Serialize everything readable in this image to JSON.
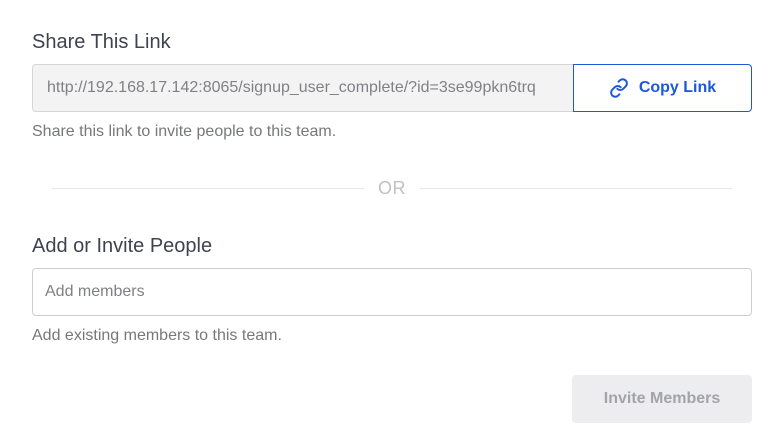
{
  "share": {
    "title": "Share This Link",
    "link_value": "http://192.168.17.142:8065/signup_user_complete/?id=3se99pkn6trq",
    "copy_label": "Copy Link",
    "copy_icon": "link-icon",
    "help": "Share this link to invite people to this team."
  },
  "divider": {
    "label": "OR"
  },
  "invite": {
    "title": "Add or Invite People",
    "placeholder": "Add members",
    "help": "Add existing members to this team.",
    "submit_label": "Invite Members"
  },
  "colors": {
    "accent": "#1c58d9",
    "disabled_bg": "#ededef",
    "disabled_text": "#a3a4a8"
  }
}
